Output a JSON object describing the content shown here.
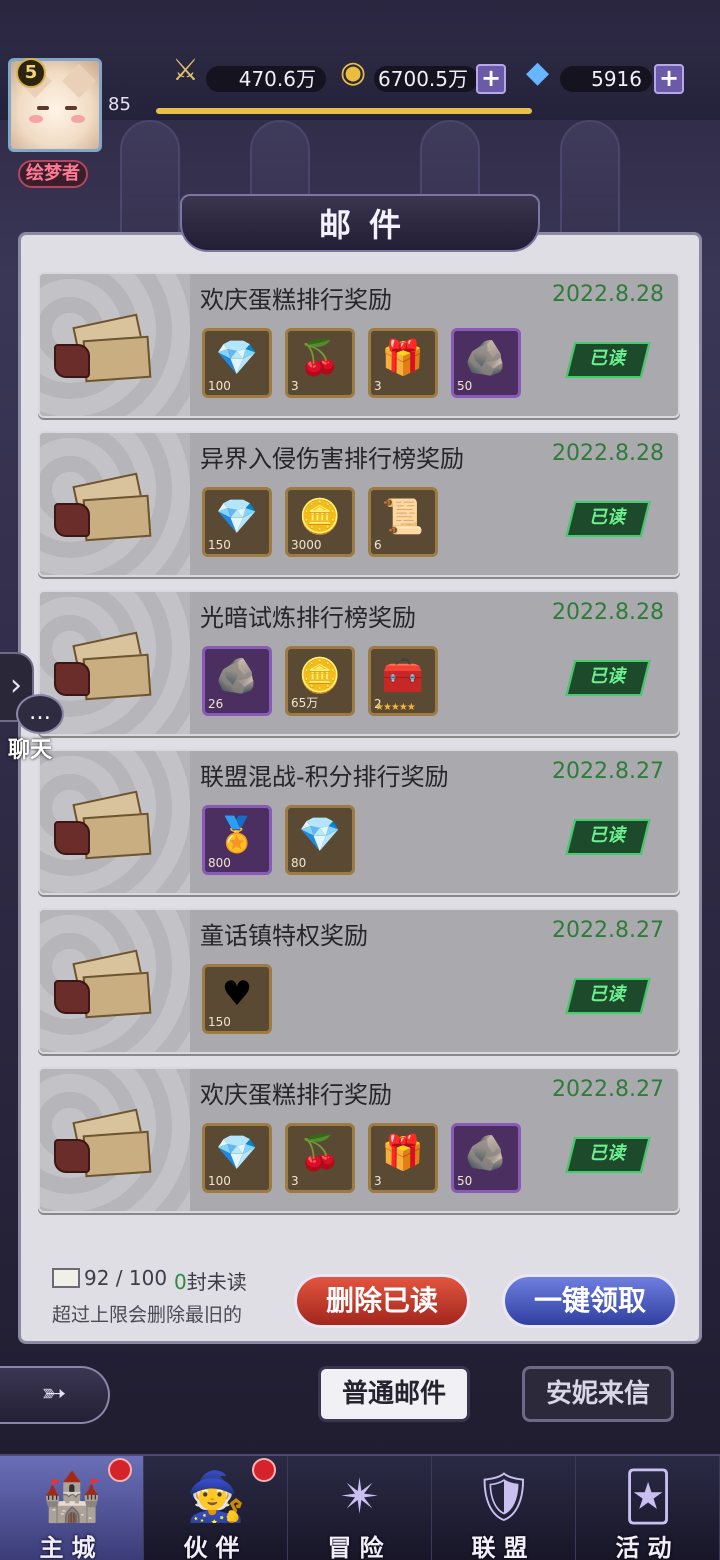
{
  "player": {
    "level": "5",
    "exp_level": "85",
    "title_badge": "绘梦者"
  },
  "resources": {
    "power": "470.6万",
    "gold": "6700.5万",
    "diamonds": "5916"
  },
  "header": {
    "title": "邮件"
  },
  "mails": [
    {
      "title": "欢庆蛋糕排行奖励",
      "date": "2022.8.28",
      "status": "已读",
      "items": [
        {
          "icon": "diamond-icon",
          "glyph": "💎",
          "count": "100",
          "frame": "gold"
        },
        {
          "icon": "cake-icon",
          "glyph": "🍒",
          "count": "3",
          "frame": "gold"
        },
        {
          "icon": "treasure-box-icon",
          "glyph": "🎁",
          "count": "3",
          "frame": "gold"
        },
        {
          "icon": "rune-stone-icon",
          "glyph": "🪨",
          "count": "50",
          "frame": "purple"
        }
      ]
    },
    {
      "title": "异界入侵伤害排行榜奖励",
      "date": "2022.8.28",
      "status": "已读",
      "items": [
        {
          "icon": "diamond-icon",
          "glyph": "💎",
          "count": "150",
          "frame": "gold"
        },
        {
          "icon": "gold-coin-icon",
          "glyph": "🪙",
          "count": "3000",
          "frame": "gold"
        },
        {
          "icon": "scroll-icon",
          "glyph": "📜",
          "count": "6",
          "frame": "gold"
        }
      ]
    },
    {
      "title": "光暗试炼排行榜奖励",
      "date": "2022.8.28",
      "status": "已读",
      "items": [
        {
          "icon": "rune-stone-icon",
          "glyph": "🪨",
          "count": "26",
          "frame": "purple"
        },
        {
          "icon": "gold-coin-icon",
          "glyph": "🪙",
          "count": "65万",
          "frame": "gold"
        },
        {
          "icon": "hero-chest-icon",
          "glyph": "🧰",
          "count": "2",
          "frame": "gold",
          "stars": "★★★★★"
        }
      ]
    },
    {
      "title": "联盟混战-积分排行奖励",
      "date": "2022.8.27",
      "status": "已读",
      "items": [
        {
          "icon": "alliance-medal-icon",
          "glyph": "🏅",
          "count": "800",
          "frame": "purple"
        },
        {
          "icon": "diamond-icon",
          "glyph": "💎",
          "count": "80",
          "frame": "gold"
        }
      ]
    },
    {
      "title": "童话镇特权奖励",
      "date": "2022.8.27",
      "status": "已读",
      "items": [
        {
          "icon": "heart-gem-icon",
          "glyph": "♥",
          "count": "150",
          "frame": "gold"
        }
      ]
    },
    {
      "title": "欢庆蛋糕排行奖励",
      "date": "2022.8.27",
      "status": "已读",
      "items": [
        {
          "icon": "diamond-icon",
          "glyph": "💎",
          "count": "100",
          "frame": "gold"
        },
        {
          "icon": "cake-icon",
          "glyph": "🍒",
          "count": "3",
          "frame": "gold"
        },
        {
          "icon": "treasure-box-icon",
          "glyph": "🎁",
          "count": "3",
          "frame": "gold"
        },
        {
          "icon": "rune-stone-icon",
          "glyph": "🪨",
          "count": "50",
          "frame": "purple"
        }
      ]
    }
  ],
  "footer": {
    "mail_count": "92 / 100",
    "unread_num": "0",
    "unread_label": "封未读",
    "hint": "超过上限会删除最旧的",
    "delete_label": "删除已读",
    "claim_label": "一键领取"
  },
  "tabs": {
    "normal": "普通邮件",
    "annie": "安妮来信"
  },
  "chat": {
    "label": "聊天"
  },
  "nav": [
    {
      "name": "main-city",
      "label": "主城",
      "glyph": "🏰",
      "active": true,
      "dot": true
    },
    {
      "name": "partners",
      "label": "伙伴",
      "glyph": "🧙",
      "active": false,
      "dot": true
    },
    {
      "name": "adventure",
      "label": "冒险",
      "glyph": "✴",
      "active": false,
      "dot": false
    },
    {
      "name": "alliance",
      "label": "联盟",
      "glyph": "🛡",
      "active": false,
      "dot": false
    },
    {
      "name": "events",
      "label": "活动",
      "glyph": "🃏",
      "active": false,
      "dot": false
    }
  ]
}
